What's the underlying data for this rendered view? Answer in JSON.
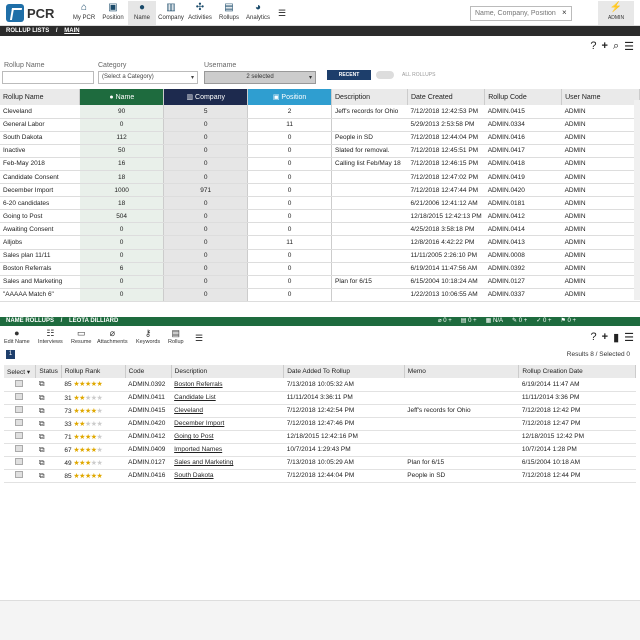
{
  "nav": {
    "logo": "PCR",
    "items": [
      "My PCR",
      "Position",
      "Name",
      "Company",
      "Activities",
      "Rollups",
      "Analytics"
    ],
    "search_placeholder": "Name, Company, Position",
    "user": "ADMIN"
  },
  "rollup_bar": {
    "title": "ROLLUP LISTS",
    "sep": "/",
    "crumb": "MAIN"
  },
  "filters": {
    "rollup_name_label": "Rollup Name",
    "category_label": "Category",
    "category_value": "(Select a Category)",
    "username_label": "Username",
    "username_value": "2 selected",
    "recent": "RECENT ROLLUPS",
    "all": "ALL ROLLUPS"
  },
  "table1": {
    "headers": [
      "Rollup Name",
      "Name",
      "Company",
      "Position",
      "Description",
      "Date Created",
      "Rollup Code",
      "User Name"
    ],
    "rows": [
      [
        "Cleveland",
        "90",
        "5",
        "2",
        "Jeff's records for Ohio",
        "7/12/2018 12:42:53 PM",
        "ADMIN.0415",
        "ADMIN"
      ],
      [
        "General Labor",
        "0",
        "0",
        "11",
        "",
        "5/29/2013 2:53:58 PM",
        "ADMIN.0334",
        "ADMIN"
      ],
      [
        "South Dakota",
        "112",
        "0",
        "0",
        "People in SD",
        "7/12/2018 12:44:04 PM",
        "ADMIN.0416",
        "ADMIN"
      ],
      [
        "Inactive",
        "50",
        "0",
        "0",
        "Slated for removal.",
        "7/12/2018 12:45:51 PM",
        "ADMIN.0417",
        "ADMIN"
      ],
      [
        "Feb-May 2018",
        "16",
        "0",
        "0",
        "Calling list Feb/May 18",
        "7/12/2018 12:46:15 PM",
        "ADMIN.0418",
        "ADMIN"
      ],
      [
        "Candidate Consent",
        "18",
        "0",
        "0",
        "",
        "7/12/2018 12:47:02 PM",
        "ADMIN.0419",
        "ADMIN"
      ],
      [
        "December Import",
        "1000",
        "971",
        "0",
        "",
        "7/12/2018 12:47:44 PM",
        "ADMIN.0420",
        "ADMIN"
      ],
      [
        "6-20 candidates",
        "18",
        "0",
        "0",
        "",
        "6/21/2006 12:41:12 AM",
        "ADMIN.0181",
        "ADMIN"
      ],
      [
        "Going to Post",
        "504",
        "0",
        "0",
        "",
        "12/18/2015 12:42:13 PM",
        "ADMIN.0412",
        "ADMIN"
      ],
      [
        "Awaiting Consent",
        "0",
        "0",
        "0",
        "",
        "4/25/2018 3:58:18 PM",
        "ADMIN.0414",
        "ADMIN"
      ],
      [
        "Alljobs",
        "0",
        "0",
        "11",
        "",
        "12/8/2016 4:42:22 PM",
        "ADMIN.0413",
        "ADMIN"
      ],
      [
        "Sales plan 11/11",
        "0",
        "0",
        "0",
        "",
        "11/11/2005 2:26:10 PM",
        "ADMIN.0008",
        "ADMIN"
      ],
      [
        "Boston Referrals",
        "6",
        "0",
        "0",
        "",
        "6/19/2014 11:47:56 AM",
        "ADMIN.0392",
        "ADMIN"
      ],
      [
        "Sales and Marketing",
        "0",
        "0",
        "0",
        "Plan for 6/15",
        "6/15/2004 10:18:24 AM",
        "ADMIN.0127",
        "ADMIN"
      ],
      [
        "\"AAAAA Match 6\"",
        "0",
        "0",
        "0",
        "",
        "1/22/2013 10:06:55 AM",
        "ADMIN.0337",
        "ADMIN"
      ]
    ]
  },
  "name_bar": {
    "title": "NAME ROLLUPS",
    "sep": "/",
    "crumb": "LEOTA DILLIARD",
    "badges": [
      "0",
      "0",
      "N/A",
      "0",
      "0",
      "0"
    ]
  },
  "subtools": [
    "Edit Name",
    "Interviews",
    "Resume",
    "Attachments",
    "Keywords",
    "Rollup"
  ],
  "pager": {
    "page": "1",
    "results": "Results 8 / Selected 0"
  },
  "table2": {
    "headers": [
      "Select",
      "Status",
      "Rollup Rank",
      "Code",
      "Description",
      "Date Added To Rollup",
      "Memo",
      "Rollup Creation Date"
    ],
    "rows": [
      {
        "rank": "85",
        "stars": 5,
        "code": "ADMIN.0392",
        "desc": "Boston Referrals",
        "added": "7/13/2018 10:05:32 AM",
        "memo": "",
        "created": "6/19/2014 11:47 AM"
      },
      {
        "rank": "31",
        "stars": 2,
        "code": "ADMIN.0411",
        "desc": "Candidate List",
        "added": "11/11/2014 3:36:11 PM",
        "memo": "",
        "created": "11/11/2014 3:36 PM"
      },
      {
        "rank": "73",
        "stars": 4,
        "code": "ADMIN.0415",
        "desc": "Cleveland",
        "added": "7/12/2018 12:42:54 PM",
        "memo": "Jeff's records for Ohio",
        "created": "7/12/2018 12:42 PM"
      },
      {
        "rank": "33",
        "stars": 2,
        "code": "ADMIN.0420",
        "desc": "December Import",
        "added": "7/12/2018 12:47:46 PM",
        "memo": "",
        "created": "7/12/2018 12:47 PM"
      },
      {
        "rank": "71",
        "stars": 4,
        "code": "ADMIN.0412",
        "desc": "Going to Post",
        "added": "12/18/2015 12:42:16 PM",
        "memo": "",
        "created": "12/18/2015 12:42 PM"
      },
      {
        "rank": "67",
        "stars": 4,
        "code": "ADMIN.0409",
        "desc": "Imported Names",
        "added": "10/7/2014 1:29:43 PM",
        "memo": "",
        "created": "10/7/2014 1:28 PM"
      },
      {
        "rank": "49",
        "stars": 3,
        "code": "ADMIN.0127",
        "desc": "Sales and Marketing",
        "added": "7/13/2018 10:05:29 AM",
        "memo": "Plan for 6/15",
        "created": "6/15/2004 10:18 AM"
      },
      {
        "rank": "85",
        "stars": 5,
        "code": "ADMIN.0416",
        "desc": "South Dakota",
        "added": "7/12/2018 12:44:04 PM",
        "memo": "People in SD",
        "created": "7/12/2018 12:44 PM"
      }
    ]
  }
}
